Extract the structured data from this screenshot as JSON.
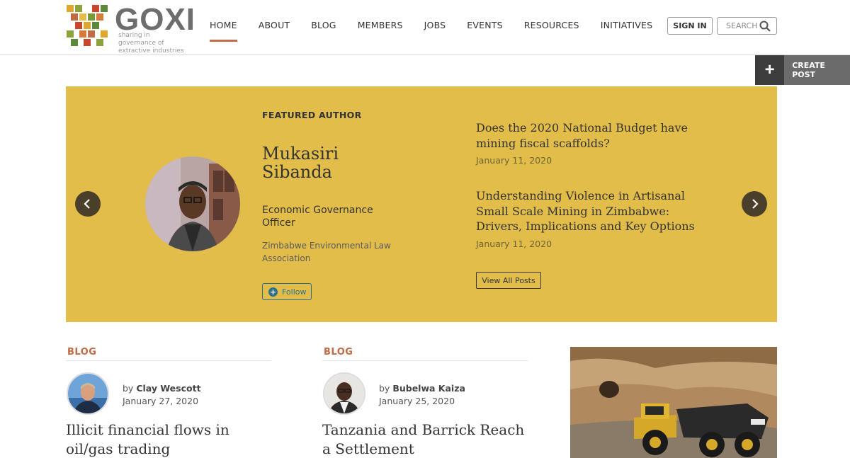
{
  "header": {
    "logo_text": "GOXI",
    "logo_tagline": "sharing in governance of extractive industries",
    "nav": [
      "HOME",
      "ABOUT",
      "BLOG",
      "MEMBERS",
      "JOBS",
      "EVENTS",
      "RESOURCES",
      "INITIATIVES"
    ],
    "active_nav": "HOME",
    "signin_label": "SIGN IN",
    "search_placeholder": "SEARCH"
  },
  "create_post": {
    "label": "CREATE POST",
    "icon": "plus-icon"
  },
  "featured": {
    "section_label": "FEATURED AUTHOR",
    "author_name": "Mukasiri Sibanda",
    "author_role": "Economic Governance Officer",
    "author_org": "Zimbabwe Environmental Law Association",
    "follow_label": "Follow",
    "posts": [
      {
        "title": "Does the 2020 National Budget have mining fiscal scaffolds?",
        "date": "January 11, 2020"
      },
      {
        "title": "Understanding Violence in Artisanal Small Scale Mining in Zimbabwe: Drivers, Implications and Key Options",
        "date": "January 11, 2020"
      }
    ],
    "view_all_label": "View All Posts",
    "background_color": "#e2bd4a"
  },
  "cards": [
    {
      "category": "BLOG",
      "by": "by",
      "author": "Clay Wescott",
      "date": "January 27, 2020",
      "title": "Illicit financial flows  in oil/gas trading"
    },
    {
      "category": "BLOG",
      "by": "by",
      "author": "Bubelwa Kaiza",
      "date": "January 25, 2020",
      "title": "Tanzania and Barrick Reach a Settlement"
    }
  ],
  "colors": {
    "accent": "#c36b45",
    "follow_blue": "#2a6f8e"
  }
}
